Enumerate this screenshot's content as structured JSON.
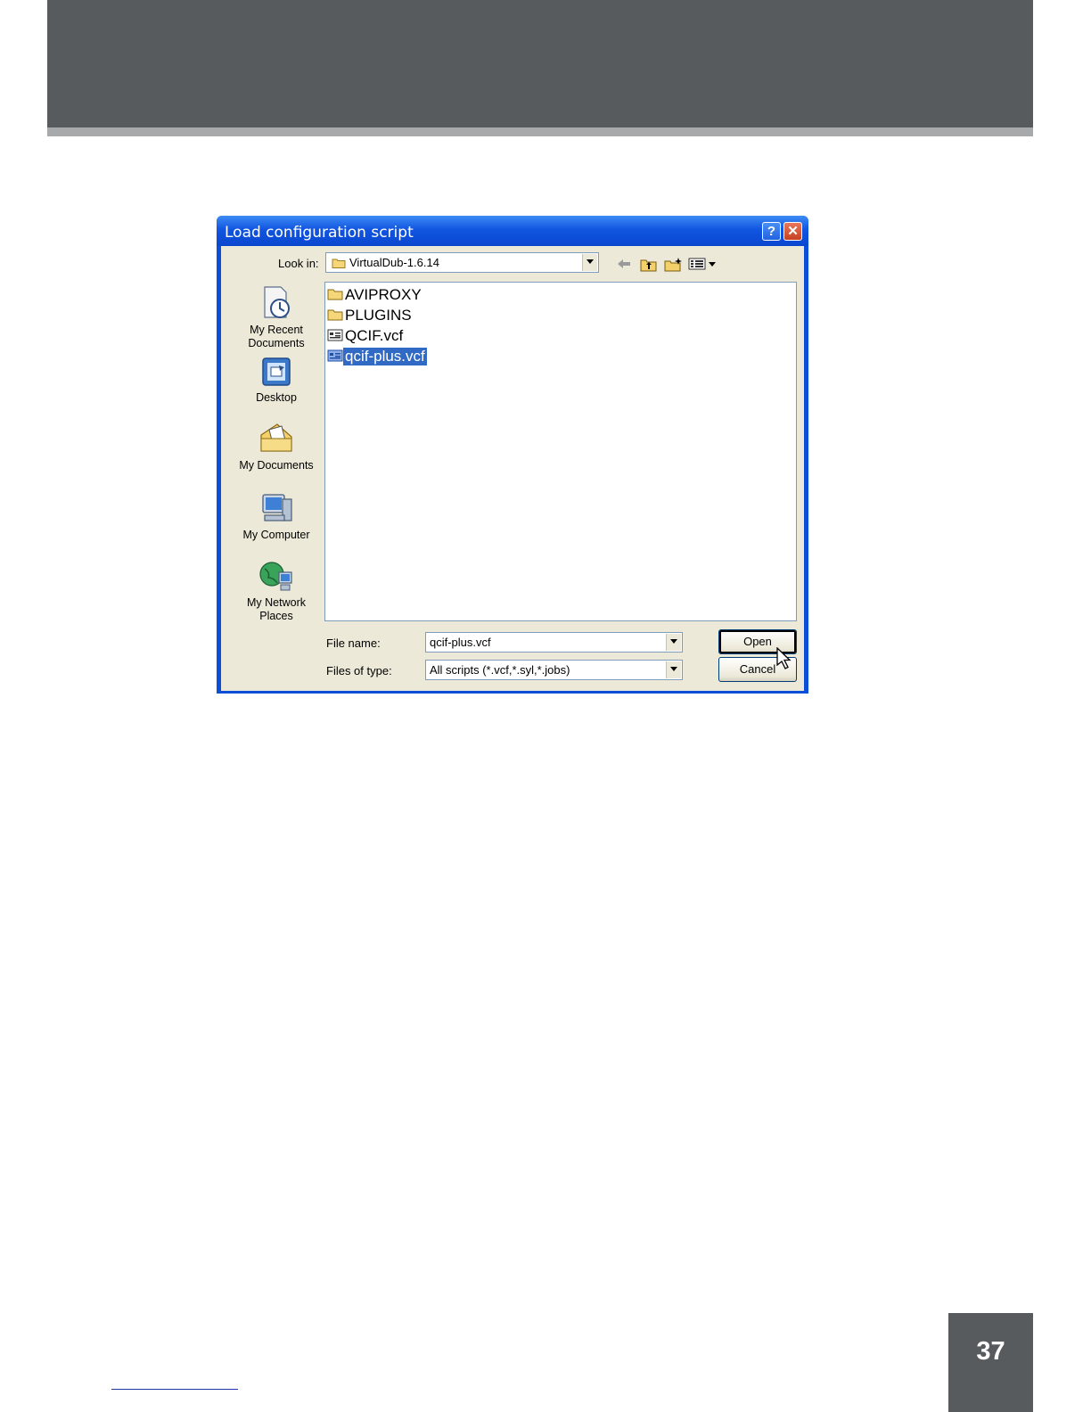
{
  "page": {
    "page_number": "37"
  },
  "dialog": {
    "title": "Load configuration script",
    "help_button": "?",
    "close_button": "✕",
    "look_in_label": "Look in:",
    "look_in_value": "VirtualDub-1.6.14",
    "places": [
      {
        "label_line1": "My Recent",
        "label_line2": "Documents",
        "icon": "recent-documents-icon"
      },
      {
        "label_line1": "Desktop",
        "label_line2": "",
        "icon": "desktop-icon"
      },
      {
        "label_line1": "My Documents",
        "label_line2": "",
        "icon": "my-documents-icon"
      },
      {
        "label_line1": "My Computer",
        "label_line2": "",
        "icon": "my-computer-icon"
      },
      {
        "label_line1": "My Network",
        "label_line2": "Places",
        "icon": "network-places-icon"
      }
    ],
    "files": [
      {
        "name": "AVIPROXY",
        "type": "folder"
      },
      {
        "name": "PLUGINS",
        "type": "folder"
      },
      {
        "name": "QCIF.vcf",
        "type": "script"
      },
      {
        "name": "qcif-plus.vcf",
        "type": "script",
        "selected": true
      }
    ],
    "file_name_label": "File name:",
    "file_name_value": "qcif-plus.vcf",
    "files_of_type_label": "Files of type:",
    "files_of_type_value": "All scripts (*.vcf,*.syl,*.jobs)",
    "open_button": "Open",
    "cancel_button": "Cancel"
  }
}
